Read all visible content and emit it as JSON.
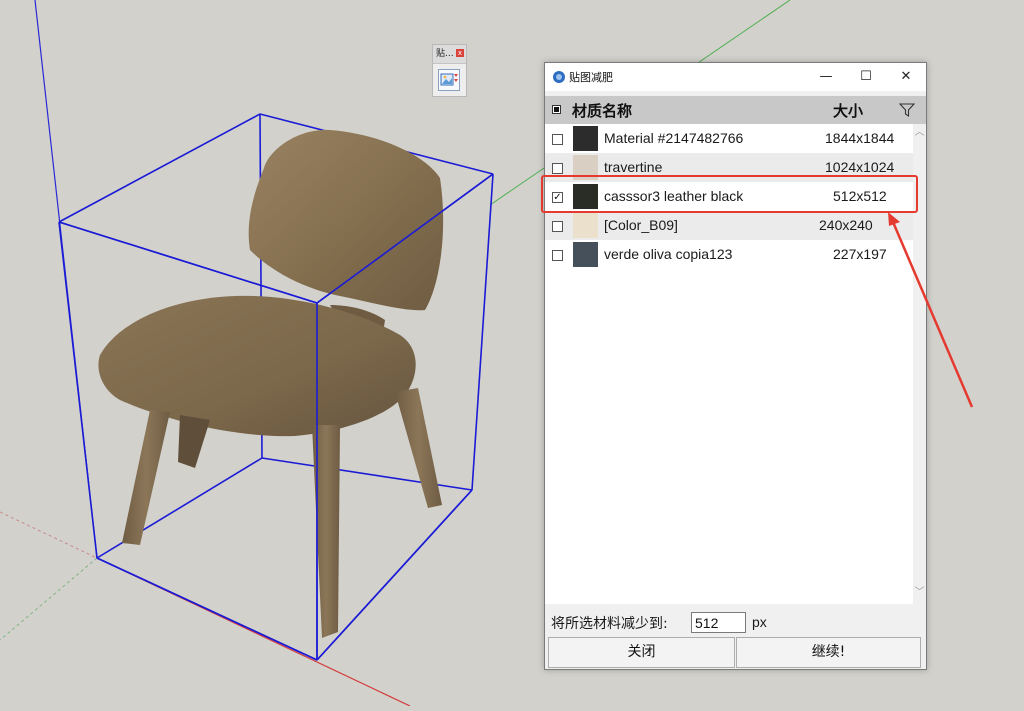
{
  "toolbar": {
    "title": "贴...",
    "close": "x"
  },
  "dialog": {
    "title": "贴图减肥",
    "window_buttons": {
      "minimize": "—",
      "maximize": "☐",
      "close": "✕"
    },
    "columns": {
      "name": "材质名称",
      "size": "大小"
    },
    "materials": [
      {
        "name": "Material #2147482766",
        "size": "1844x1844",
        "checked": false,
        "swatch": "#2c2c2c"
      },
      {
        "name": "travertine",
        "size": "1024x1024",
        "checked": false,
        "swatch": "#d9cfc2"
      },
      {
        "name": "casssor3 leather black",
        "size": "512x512",
        "checked": true,
        "swatch": "#2a2d26"
      },
      {
        "name": "[Color_B09]",
        "size": "240x240",
        "checked": false,
        "swatch": "#ebe0cc"
      },
      {
        "name": "verde oliva copia123",
        "size": "227x197",
        "checked": false,
        "swatch": "#46505a"
      }
    ],
    "reduce_label": "将所选材料减少到:",
    "reduce_value": "512",
    "reduce_unit": "px",
    "close_button": "关闭",
    "continue_button": "继续!"
  },
  "colors": {
    "highlight": "#e53a2f",
    "bbox_edges": "#1b1bd6",
    "chair_wood": "#8a7356"
  }
}
